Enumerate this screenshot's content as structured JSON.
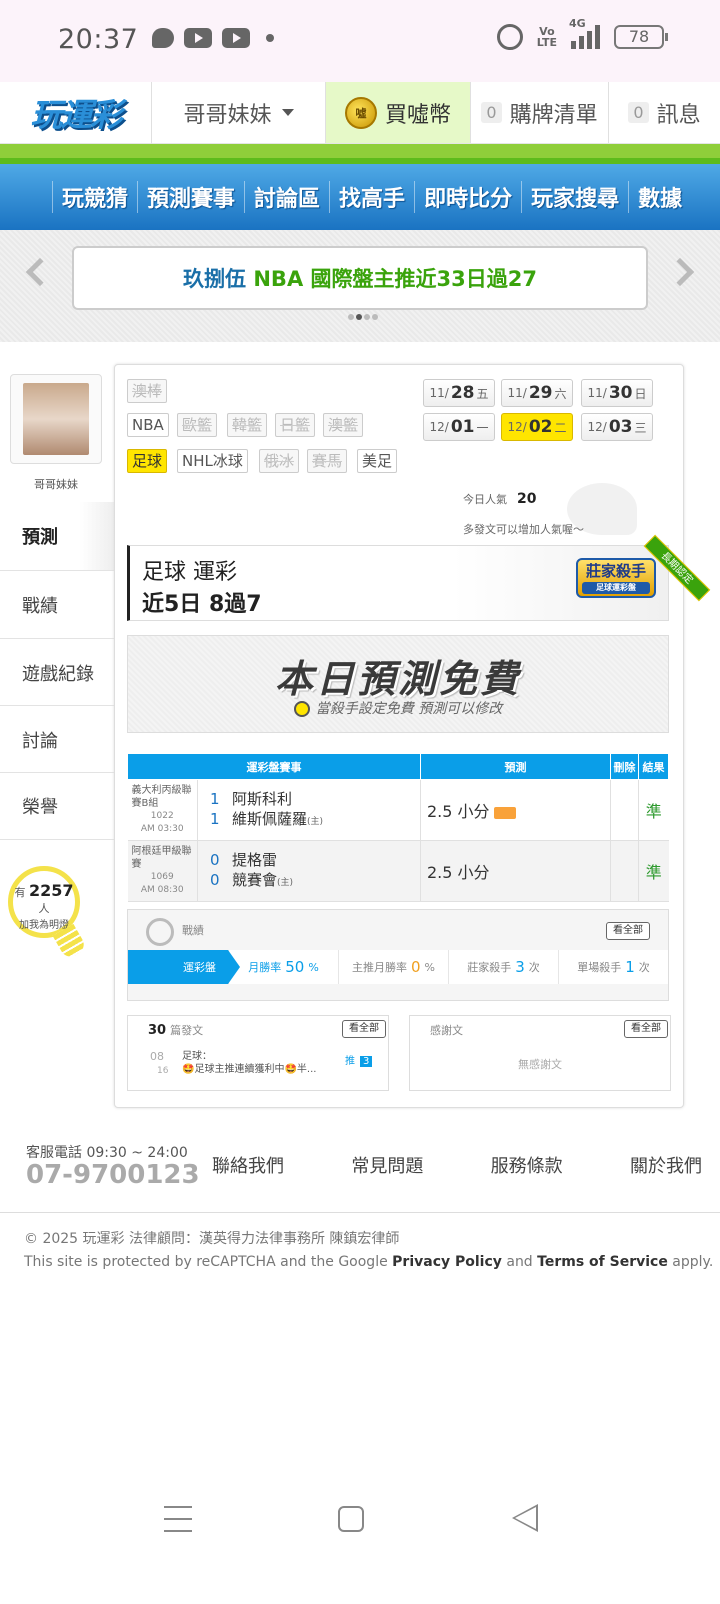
{
  "status_bar": {
    "time": "20:37",
    "network": "4G",
    "battery": "78",
    "icons": [
      "chat-icon",
      "youtube-icon",
      "youtube-icon",
      "alarm-icon",
      "volte-icon",
      "signal-icon",
      "battery-icon"
    ]
  },
  "header": {
    "logo": "玩運彩",
    "user_menu": "哥哥妹妹",
    "buy_coin": "買噓幣",
    "coin_icon_text": "噓",
    "cart_count": "0",
    "cart_label": "購牌清單",
    "msg_count": "0",
    "msg_label": "訊息"
  },
  "main_menu": [
    "玩競猜",
    "預測賽事",
    "討論區",
    "找高手",
    "即時比分",
    "玩家搜尋",
    "數據"
  ],
  "banner": {
    "part1": "玖捌伍",
    "part2": "NBA 國際盤主推近33日過27"
  },
  "profile": {
    "name": "哥哥妹妹",
    "fans_prefix": "有",
    "fans_count": "2257",
    "fans_suffix": "人",
    "fans_tip": "加我為明燈"
  },
  "side_tabs": [
    "預測",
    "戰績",
    "遊戲紀錄",
    "討論",
    "榮譽"
  ],
  "sport_tags": {
    "row0": [
      "澳棒"
    ],
    "row1": [
      "NBA",
      "歐籃",
      "韓籃",
      "日籃",
      "澳籃"
    ],
    "row2": [
      "足球",
      "NHL冰球",
      "俄冰",
      "賽馬",
      "美足"
    ]
  },
  "dates": [
    {
      "m": "11/",
      "d": "28",
      "w": "五"
    },
    {
      "m": "11/",
      "d": "29",
      "w": "六"
    },
    {
      "m": "11/",
      "d": "30",
      "w": "日"
    },
    {
      "m": "12/",
      "d": "01",
      "w": "一"
    },
    {
      "m": "12/",
      "d": "02",
      "w": "二"
    },
    {
      "m": "12/",
      "d": "03",
      "w": "三"
    }
  ],
  "popularity": {
    "label": "今日人氣",
    "value": "20",
    "tip": "多發文可以增加人氣喔～"
  },
  "ticket": {
    "line1": "足球 運彩",
    "line2": "近5日 8過7",
    "badge": "莊家殺手",
    "badge_sub": "足球運彩盤",
    "ribbon": "長期認定"
  },
  "free_box": {
    "title": "本日預測免費",
    "sub": "當殺手設定免費 預測可以修改"
  },
  "table": {
    "headers": [
      "運彩盤賽事",
      "預測",
      "刪除",
      "結果"
    ],
    "rows": [
      {
        "league": "義大利丙級聯賽B組",
        "code": "1022",
        "time": "AM 03:30",
        "n1": "1",
        "team1": "阿斯科利",
        "n2": "1",
        "team2": "維斯佩薩羅",
        "home": "(主)",
        "pick": "2.5 小分",
        "result": "準"
      },
      {
        "league": "阿根廷甲級聯賽",
        "code": "1069",
        "time": "AM 08:30",
        "n1": "0",
        "team1": "提格雷",
        "n2": "0",
        "team2": "競賽會",
        "home": "(主)",
        "pick": "2.5 小分",
        "result": "準"
      }
    ]
  },
  "stats": {
    "title": "戰績",
    "view_all": "看全部",
    "lead": "運彩盤",
    "monthly_label": "月勝率",
    "monthly_value": "50",
    "monthly_unit": "%",
    "host_label": "主推月勝率",
    "host_value": "0",
    "host_unit": "%",
    "banker_label": "莊家殺手",
    "banker_value": "3",
    "banker_unit": "次",
    "single_label": "單場殺手",
    "single_value": "1",
    "single_unit": "次"
  },
  "posts": {
    "count": "30",
    "label": "篇發文",
    "view_all": "看全部",
    "month": "08",
    "day": "16",
    "title": "足球：",
    "text": "🤩足球主推連續獲利中🤩半...",
    "push_label": "推",
    "push_count": "3"
  },
  "thanks": {
    "label": "感謝文",
    "view_all": "看全部",
    "empty": "無感謝文"
  },
  "footer": {
    "tel_label": "客服電話 09:30 ~ 24:00",
    "tel": "07-9700123",
    "links": [
      "聯絡我們",
      "常見問題",
      "服務條款",
      "關於我們"
    ],
    "copyright": "© 2025 玩運彩 法律顧問：漢英得力法律事務所 陳鎮宏律師",
    "recaptcha_pre": "This site is protected by reCAPTCHA and the Google",
    "privacy": "Privacy Policy",
    "and": "and",
    "terms": "Terms of Service",
    "apply": "apply."
  }
}
